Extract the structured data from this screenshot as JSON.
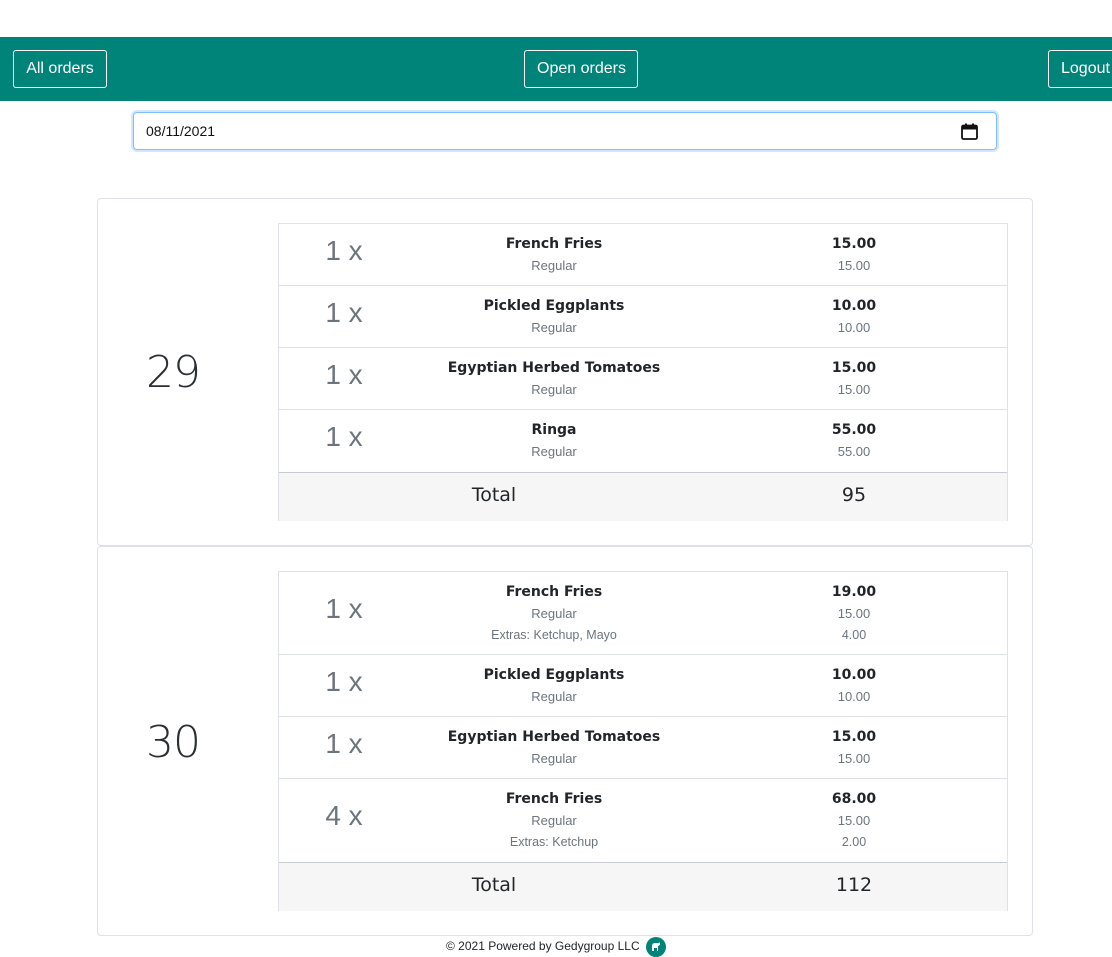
{
  "navbar": {
    "all_orders": "All orders",
    "open_orders": "Open orders",
    "logout": "Logout"
  },
  "date_filter": {
    "value": "08/11/2021",
    "icon": "calendar-icon"
  },
  "orders": [
    {
      "number": "29",
      "items": [
        {
          "qty": "1 x",
          "name": "French Fries",
          "variant": "Regular",
          "total": "15.00",
          "variant_price": "15.00"
        },
        {
          "qty": "1 x",
          "name": "Pickled Eggplants",
          "variant": "Regular",
          "total": "10.00",
          "variant_price": "10.00"
        },
        {
          "qty": "1 x",
          "name": "Egyptian Herbed Tomatoes",
          "variant": "Regular",
          "total": "15.00",
          "variant_price": "15.00"
        },
        {
          "qty": "1 x",
          "name": "Ringa",
          "variant": "Regular",
          "total": "55.00",
          "variant_price": "55.00"
        }
      ],
      "total_label": "Total",
      "total_value": "95"
    },
    {
      "number": "30",
      "items": [
        {
          "qty": "1 x",
          "name": "French Fries",
          "variant": "Regular",
          "extras": "Extras: Ketchup, Mayo",
          "total": "19.00",
          "variant_price": "15.00",
          "extras_price": "4.00"
        },
        {
          "qty": "1 x",
          "name": "Pickled Eggplants",
          "variant": "Regular",
          "total": "10.00",
          "variant_price": "10.00"
        },
        {
          "qty": "1 x",
          "name": "Egyptian Herbed Tomatoes",
          "variant": "Regular",
          "total": "15.00",
          "variant_price": "15.00"
        },
        {
          "qty": "4 x",
          "name": "French Fries",
          "variant": "Regular",
          "extras": "Extras: Ketchup",
          "total": "68.00",
          "variant_price": "15.00",
          "extras_price": "2.00"
        }
      ],
      "total_label": "Total",
      "total_value": "112"
    }
  ],
  "footer": {
    "text": "© 2021 Powered by Gedygroup LLC",
    "logo_icon": "gedygroup-logo-icon"
  },
  "colors": {
    "navbar": "#008479",
    "focus_border": "#80bdff",
    "muted": "#6c757d"
  }
}
